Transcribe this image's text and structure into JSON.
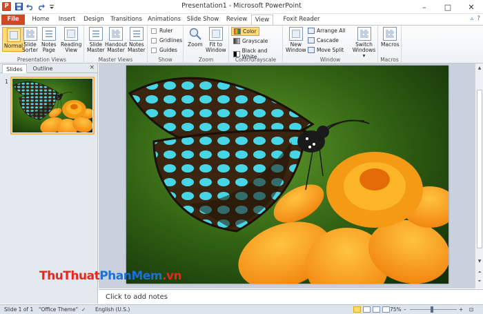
{
  "window": {
    "app_logo": "P",
    "title": "Presentation1 - Microsoft PowerPoint",
    "controls": [
      "–",
      "□",
      "✕"
    ]
  },
  "quick_access": {
    "icons": [
      "save-icon",
      "undo-icon",
      "redo-icon",
      "customize-icon"
    ]
  },
  "tabs": [
    {
      "label": "File"
    },
    {
      "label": "Home"
    },
    {
      "label": "Insert"
    },
    {
      "label": "Design"
    },
    {
      "label": "Transitions"
    },
    {
      "label": "Animations"
    },
    {
      "label": "Slide Show"
    },
    {
      "label": "Review"
    },
    {
      "label": "View"
    },
    {
      "label": "Foxit Reader PDF"
    }
  ],
  "ribbon": {
    "presentation_views": {
      "label": "Presentation Views",
      "buttons": [
        {
          "line1": "Normal",
          "line2": ""
        },
        {
          "line1": "Slide",
          "line2": "Sorter"
        },
        {
          "line1": "Notes",
          "line2": "Page"
        },
        {
          "line1": "Reading",
          "line2": "View"
        }
      ]
    },
    "master_views": {
      "label": "Master Views",
      "buttons": [
        {
          "line1": "Slide",
          "line2": "Master"
        },
        {
          "line1": "Handout",
          "line2": "Master"
        },
        {
          "line1": "Notes",
          "line2": "Master"
        }
      ]
    },
    "show": {
      "label": "Show",
      "items": [
        "Ruler",
        "Gridlines",
        "Guides"
      ]
    },
    "zoom": {
      "label": "Zoom",
      "buttons": [
        {
          "line1": "Zoom",
          "line2": ""
        },
        {
          "line1": "Fit to",
          "line2": "Window"
        }
      ]
    },
    "color": {
      "label": "Color/Grayscale",
      "items": [
        "Color",
        "Grayscale",
        "Black and White"
      ]
    },
    "window": {
      "label": "Window",
      "new_window": {
        "line1": "New",
        "line2": "Window"
      },
      "items": [
        "Arrange All",
        "Cascade",
        "Move Split"
      ],
      "switch": {
        "line1": "Switch",
        "line2": "Windows ▾"
      }
    },
    "macros": {
      "label": "Macros",
      "button": "Macros"
    }
  },
  "left_panel": {
    "tabs": [
      "Slides",
      "Outline"
    ],
    "close": "×",
    "slide_number": "1"
  },
  "notes": {
    "placeholder": "Click to add notes"
  },
  "watermark": {
    "part1": "ThuThuat",
    "part2": "PhanMem",
    "part3": ".vn"
  },
  "status": {
    "slide": "Slide 1 of 1",
    "theme": "\"Office Theme\"",
    "language": "English (U.S.)",
    "zoom": "75%",
    "zoom_minus": "–",
    "zoom_plus": "+"
  },
  "colors": {
    "file_tab": "#d24726",
    "active_button": "#ffd97a",
    "ribbon_border": "#c6c6c6"
  }
}
